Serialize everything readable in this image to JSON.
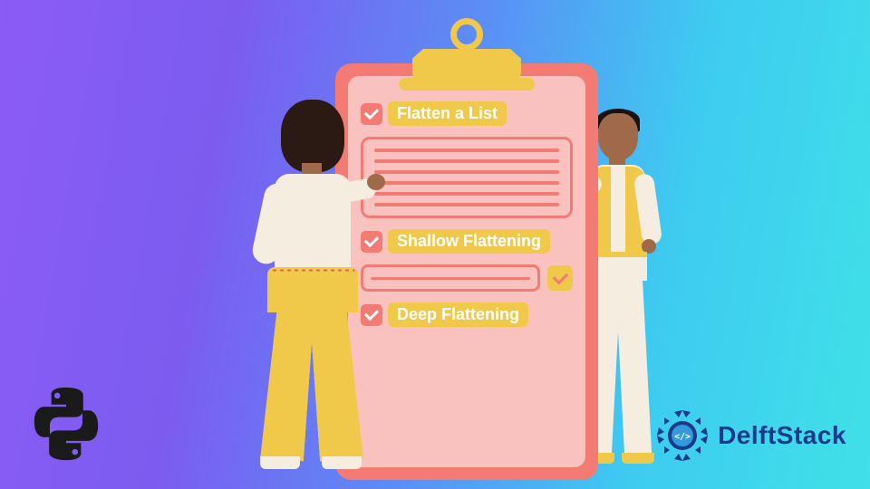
{
  "clipboard": {
    "items": [
      {
        "label": "Flatten a List"
      },
      {
        "label": "Shallow Flattening"
      },
      {
        "label": "Deep Flattening"
      }
    ]
  },
  "branding": {
    "python_icon": "python-logo",
    "delft_icon": "delftstack-logo",
    "delft_text": "DelftStack"
  },
  "colors": {
    "gradient_from": "#8b5cf6",
    "gradient_to": "#40e0e8",
    "clipboard": "#f47a74",
    "paper": "#f9c2bf",
    "accent_gold": "#f0c94b",
    "skin": "#a06a4a",
    "cream": "#f5ede0",
    "delft_blue": "#1b3a8a"
  }
}
